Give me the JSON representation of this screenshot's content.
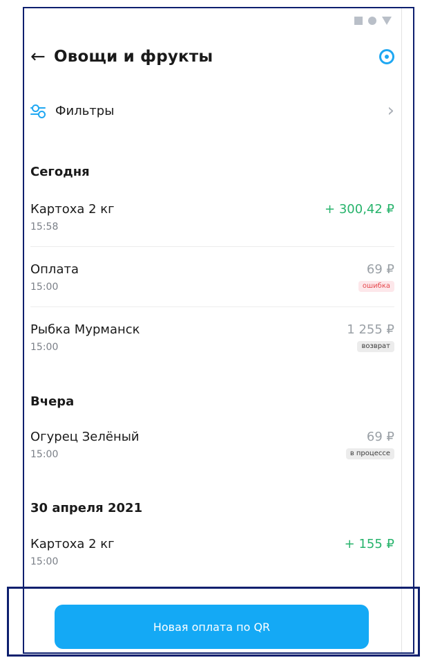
{
  "header": {
    "back_label": "←",
    "title": "Овощи и фрукты",
    "settings_icon": "settings-icon"
  },
  "filters": {
    "label": "Фильтры",
    "chevron": "›"
  },
  "groups": [
    {
      "title": "Сегодня",
      "items": [
        {
          "name": "Картоха 2 кг",
          "time": "15:58",
          "amount": "+ 300,42 ₽",
          "status": ""
        },
        {
          "name": "Оплата",
          "time": "15:00",
          "amount": "69 ₽",
          "status": "ошибка"
        },
        {
          "name": "Рыбка Мурманск",
          "time": "15:00",
          "amount": "1 255 ₽",
          "status": "возврат"
        }
      ]
    },
    {
      "title": "Вчера",
      "items": [
        {
          "name": "Огурец Зелёный",
          "time": "15:00",
          "amount": "69 ₽",
          "status": "в процессе"
        }
      ]
    },
    {
      "title": "30 апреля 2021",
      "items": [
        {
          "name": "Картоха 2 кг",
          "time": "15:00",
          "amount": "+ 155 ₽",
          "status": ""
        }
      ]
    }
  ],
  "cta": {
    "label": "Новая оплата по QR"
  },
  "colors": {
    "accent": "#1ea7f2",
    "positive": "#26b36b",
    "error": "#e5484d"
  }
}
